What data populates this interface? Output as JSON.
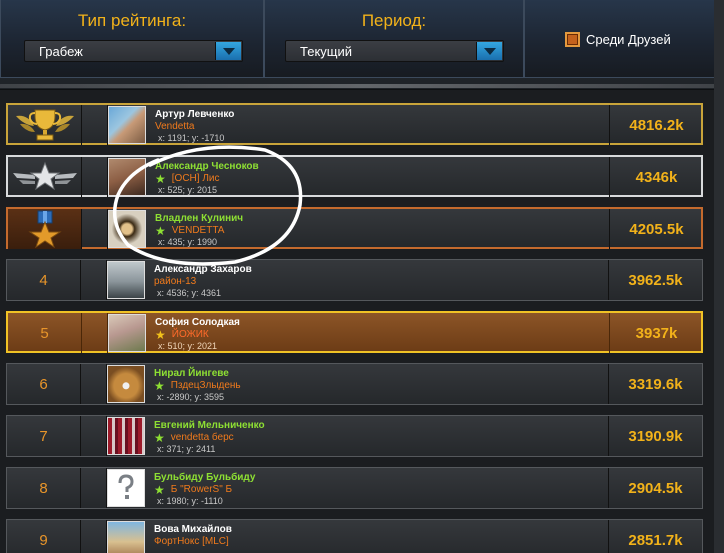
{
  "header": {
    "rating_type_label": "Тип рейтинга:",
    "rating_type_value": "Грабеж",
    "period_label": "Период:",
    "period_value": "Текущий",
    "friends_label": "Среди Друзей"
  },
  "icons": {
    "rank1": "gold-trophy-icon",
    "rank2": "silver-winged-star-icon",
    "rank3": "bronze-medal-icon",
    "dropdown": "chevron-down-icon",
    "clan_star": "star-icon"
  },
  "colors": {
    "accent_gold": "#f2b21a",
    "name_green": "#8ee033",
    "clan_orange": "#f07a1c",
    "highlight_row": "#8c5527",
    "dropdown_blue": "#34a7e0"
  },
  "rows": [
    {
      "rank": "",
      "name": "Артур Левченко",
      "clan": "Vendetta",
      "coords": "x: 1191; y: -1710",
      "score": "4816.2k",
      "star": ""
    },
    {
      "rank": "",
      "name": "Александр Чесноков",
      "clan": "[ОСН] Лис",
      "coords": "x: 525; y: 2015",
      "score": "4346k",
      "star": "★"
    },
    {
      "rank": "",
      "name": "Владлен Кулинич",
      "clan": "VENDETTA",
      "coords": "x: 435; y: 1990",
      "score": "4205.5k",
      "star": "★"
    },
    {
      "rank": "4",
      "name": "Александр Захаров",
      "clan": "район-13",
      "coords": "x: 4536; y: 4361",
      "score": "3962.5k",
      "star": ""
    },
    {
      "rank": "5",
      "name": "София Солодкая",
      "clan": "ЙОЖИК",
      "coords": "x: 510; y: 2021",
      "score": "3937k",
      "star": "★"
    },
    {
      "rank": "6",
      "name": "Нирал Йингеве",
      "clan": "ПздецЗлыдень",
      "coords": "x: -2890; y: 3595",
      "score": "3319.6k",
      "star": "★"
    },
    {
      "rank": "7",
      "name": "Евгений Мельниченко",
      "clan": "vendetta берс",
      "coords": "x: 371; y: 2411",
      "score": "3190.9k",
      "star": "★"
    },
    {
      "rank": "8",
      "name": "Бульбиду Бульбиду",
      "clan": "Б \"RowerS\" Б",
      "coords": "x: 1980; y: -1110",
      "score": "2904.5k",
      "star": "★"
    },
    {
      "rank": "9",
      "name": "Вова Михайлов",
      "clan": "ФортНокс [MLC]",
      "coords": "",
      "score": "2851.7k",
      "star": ""
    }
  ]
}
